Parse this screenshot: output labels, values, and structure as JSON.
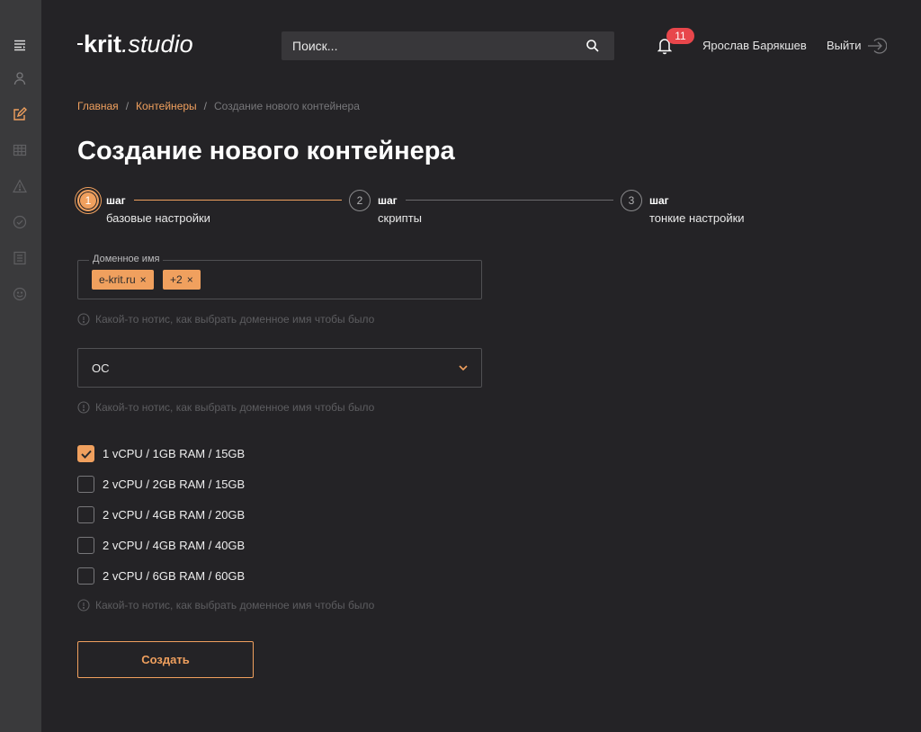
{
  "sidebar": {
    "icons": [
      "menu-icon",
      "user-icon",
      "edit-icon",
      "table-icon",
      "warning-icon",
      "check-circle-icon",
      "list-icon",
      "smile-icon"
    ],
    "active_index": 2
  },
  "header": {
    "logo_part1": "krit",
    "logo_part2": ".studio",
    "search_placeholder": "Поиск...",
    "notification_count": "11",
    "user_name": "Ярослав Барякшев",
    "logout_label": "Выйти"
  },
  "breadcrumb": {
    "home": "Главная",
    "containers": "Контейнеры",
    "current": "Создание нового контейнера",
    "separator": "/"
  },
  "page_title": "Создание нового контейнера",
  "steps": [
    {
      "number": "1",
      "word": "шаг",
      "label": "базовые настройки",
      "active": true
    },
    {
      "number": "2",
      "word": "шаг",
      "label": "скрипты",
      "active": false
    },
    {
      "number": "3",
      "word": "шаг",
      "label": "тонкие настройки",
      "active": false
    }
  ],
  "domain_field": {
    "legend": "Доменное имя",
    "chips": [
      "e-krit.ru",
      "+2"
    ],
    "chip_remove": "×"
  },
  "notice_text": "Какой-то нотис, как выбрать доменное имя чтобы было",
  "os_select": {
    "value": "ОС"
  },
  "plans": [
    {
      "label": "1 vCPU / 1GB RAM / 15GB",
      "checked": true
    },
    {
      "label": "2 vCPU / 2GB RAM / 15GB",
      "checked": false
    },
    {
      "label": "2 vCPU / 4GB RAM / 20GB",
      "checked": false
    },
    {
      "label": "2 vCPU / 4GB RAM / 40GB",
      "checked": false
    },
    {
      "label": "2 vCPU / 6GB RAM / 60GB",
      "checked": false
    }
  ],
  "create_button": "Создать",
  "colors": {
    "accent": "#f0a05e",
    "background": "#242326",
    "sidebar": "#3a3a3c",
    "badge": "#e8464b"
  }
}
